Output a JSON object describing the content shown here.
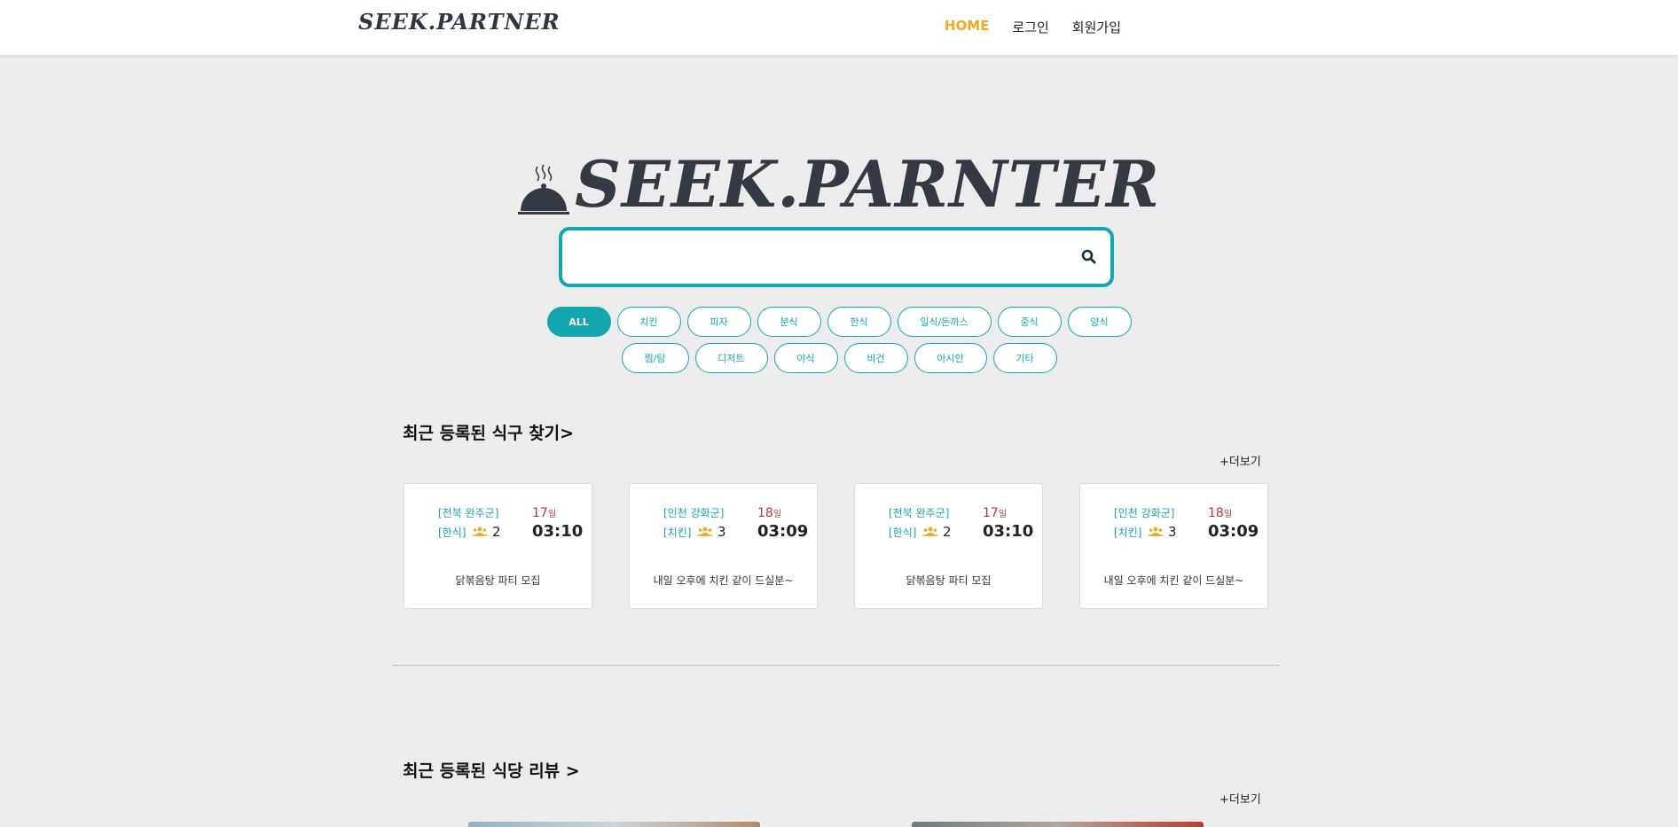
{
  "nav": {
    "logo": "SEEK.PARTNER",
    "links": [
      {
        "label": "HOME",
        "active": true
      },
      {
        "label": "로그인",
        "active": false
      },
      {
        "label": "회원가입",
        "active": false
      }
    ]
  },
  "hero": {
    "title": "SEEK.PARNTER",
    "icon": "cloche-icon"
  },
  "search": {
    "placeholder": "",
    "value": "",
    "icon": "search-icon"
  },
  "categories": {
    "row1": [
      "ALL",
      "치킨",
      "피자",
      "분식",
      "한식",
      "일식/돈까스",
      "중식",
      "양식"
    ],
    "row2": [
      "찜/탕",
      "디저트",
      "야식",
      "비건",
      "아시안",
      "기타"
    ],
    "selected": "ALL"
  },
  "recent_partners": {
    "title": "최근 등록된 식구 찾기>",
    "more": "+더보기",
    "cards": [
      {
        "region": "[전북 완주군]",
        "category": "[한식]",
        "people": "2",
        "day": "17",
        "day_unit": "일",
        "time": "03:10",
        "desc": "닭볶음탕 파티 모집"
      },
      {
        "region": "[인천 강화군]",
        "category": "[치킨]",
        "people": "3",
        "day": "18",
        "day_unit": "일",
        "time": "03:09",
        "desc": "내일 오후에 치킨 같이 드실분~"
      },
      {
        "region": "[전북 완주군]",
        "category": "[한식]",
        "people": "2",
        "day": "17",
        "day_unit": "일",
        "time": "03:10",
        "desc": "닭볶음탕 파티 모집"
      },
      {
        "region": "[인천 강화군]",
        "category": "[치킨]",
        "people": "3",
        "day": "18",
        "day_unit": "일",
        "time": "03:09",
        "desc": "내일 오후에 치킨 같이 드실분~"
      }
    ]
  },
  "recent_reviews": {
    "title": "최근 등록된 식당 리뷰 >",
    "more": "+더보기"
  },
  "colors": {
    "accent": "#13a6b1",
    "nav_active": "#f5a623",
    "day": "#b03a3a",
    "people_icon": "#f5a623",
    "background": "#ececec"
  }
}
